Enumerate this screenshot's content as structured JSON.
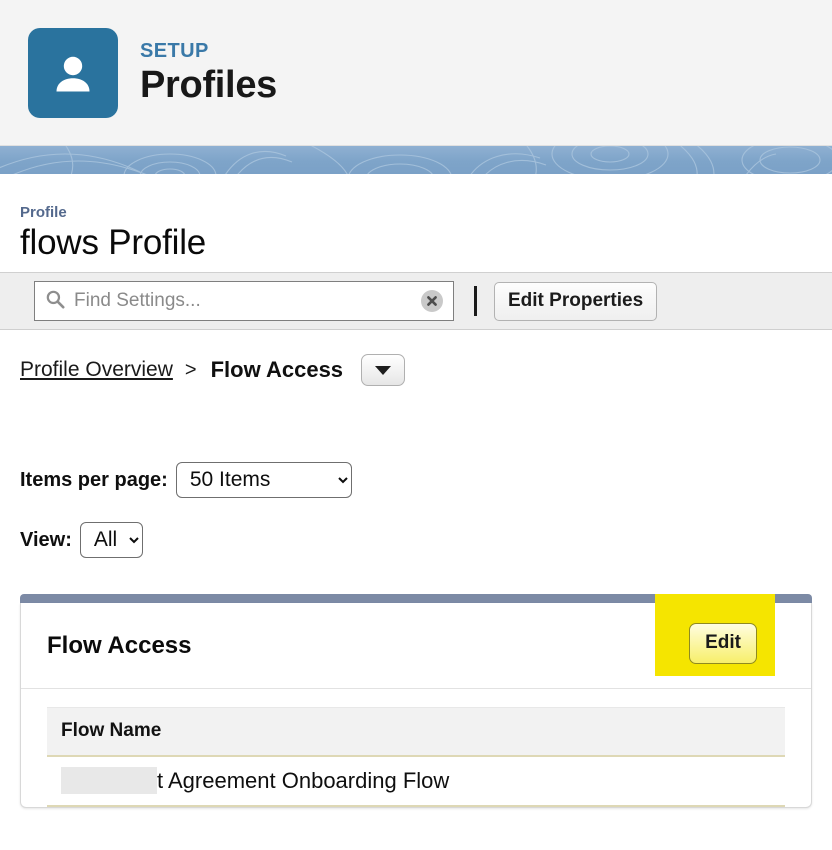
{
  "setup_header": {
    "icon": "user-profile-icon",
    "eyebrow": "SETUP",
    "title": "Profiles"
  },
  "profile": {
    "label": "Profile",
    "name": "flows Profile"
  },
  "toolbar": {
    "search_placeholder": "Find Settings...",
    "search_value": "",
    "search_icon": "search-icon",
    "clear_icon": "clear-circle-x-icon",
    "edit_properties_label": "Edit Properties"
  },
  "breadcrumb": {
    "overview_label": "Profile Overview",
    "separator": ">",
    "current_label": "Flow Access",
    "caret_icon": "chevron-down-icon"
  },
  "controls": {
    "items_per_page_label": "Items per page:",
    "items_per_page_value": "50 Items",
    "items_per_page_options": [
      "50 Items"
    ],
    "view_label": "View:",
    "view_value": "All",
    "view_options": [
      "All"
    ]
  },
  "panel": {
    "title": "Flow Access",
    "edit_label": "Edit",
    "highlight_color": "#f5e500",
    "topbar_color": "#7c8aa5"
  },
  "table": {
    "columns": [
      "Flow Name"
    ],
    "rows": [
      {
        "redacted": true,
        "name": "t Agreement Onboarding Flow"
      }
    ]
  },
  "colors": {
    "setup_icon_bg": "#2a739e",
    "setup_eyebrow": "#3a79a8",
    "banner": "#7ea4c9",
    "row_border": "#ded8b5"
  }
}
